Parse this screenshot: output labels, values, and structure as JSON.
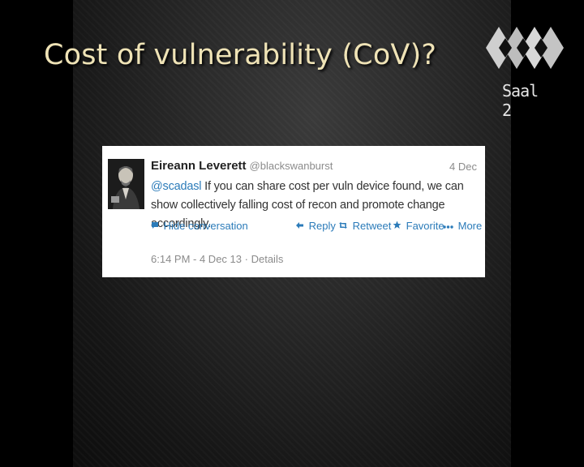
{
  "slide": {
    "title": "Cost of vulnerability (CoV)?",
    "logo_label": "Saal 2"
  },
  "tweet": {
    "author_name": "Eireann Leverett",
    "author_handle": "@blackswanburst",
    "date": "4 Dec",
    "mention": "@scadasl",
    "text": " If you can share cost per vuln device found, we can show collectively falling cost of recon and promote change accordingly.",
    "actions": {
      "hide": "Hide conversation",
      "reply": "Reply",
      "retweet": "Retweet",
      "favorite": "Favorite",
      "more": "More"
    },
    "timestamp": "6:14 PM - 4 Dec 13",
    "details": "Details"
  },
  "icons": [
    "speech-bubble-icon",
    "reply-arrow-icon",
    "retweet-icon",
    "star-icon",
    "more-dots-icon",
    "logo-icon",
    "avatar-image"
  ],
  "colors": {
    "title": "#efe3b6",
    "link": "#2b7bb9",
    "muted": "#8b8b8b"
  }
}
